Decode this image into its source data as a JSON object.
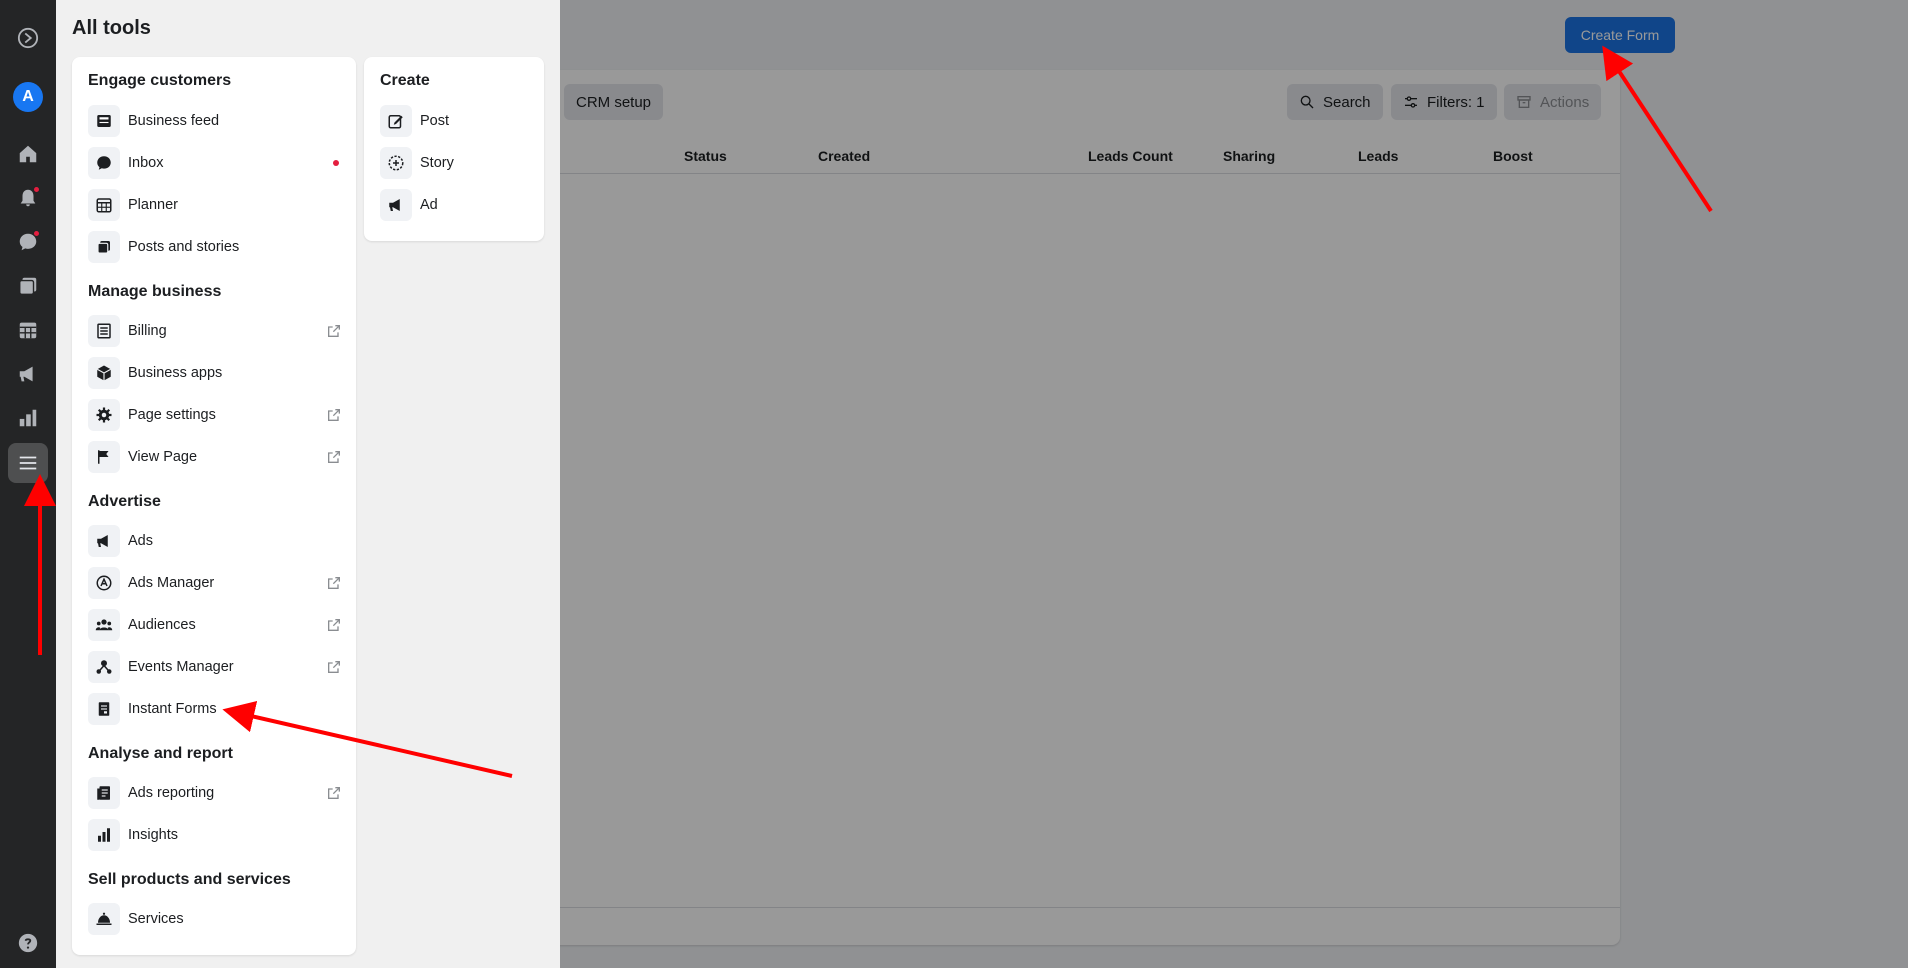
{
  "header": {
    "create_form_label": "Create Form"
  },
  "toolbar": {
    "crm_setup_label": "CRM setup",
    "search_label": "Search",
    "filters_label": "Filters: 1",
    "actions_label": "Actions"
  },
  "table": {
    "columns": [
      "Status",
      "Created",
      "Leads Count",
      "Sharing",
      "Leads",
      "Boost"
    ]
  },
  "rail": {
    "avatar_letter": "A"
  },
  "panel": {
    "title": "All tools",
    "engage": {
      "title": "Engage customers",
      "items": [
        "Business feed",
        "Inbox",
        "Planner",
        "Posts and stories"
      ]
    },
    "manage": {
      "title": "Manage business",
      "items": [
        "Billing",
        "Business apps",
        "Page settings",
        "View Page"
      ]
    },
    "advertise": {
      "title": "Advertise",
      "items": [
        "Ads",
        "Ads Manager",
        "Audiences",
        "Events Manager",
        "Instant Forms"
      ]
    },
    "analyse": {
      "title": "Analyse and report",
      "items": [
        "Ads reporting",
        "Insights"
      ]
    },
    "sell": {
      "title": "Sell products and services",
      "items": [
        "Services"
      ]
    },
    "create": {
      "title": "Create",
      "items": [
        "Post",
        "Story",
        "Ad"
      ]
    }
  },
  "colors": {
    "accent": "#1b74e4",
    "annotation_arrow": "#ff0000",
    "notification_dot": "#e41e3f"
  },
  "icons": {
    "rail": [
      "meta-logo-icon",
      "avatar",
      "home-icon",
      "bell-icon",
      "chat-icon",
      "posts-icon",
      "calendar-icon",
      "megaphone-icon",
      "bar-chart-icon",
      "menu-icon",
      "help-icon"
    ]
  }
}
